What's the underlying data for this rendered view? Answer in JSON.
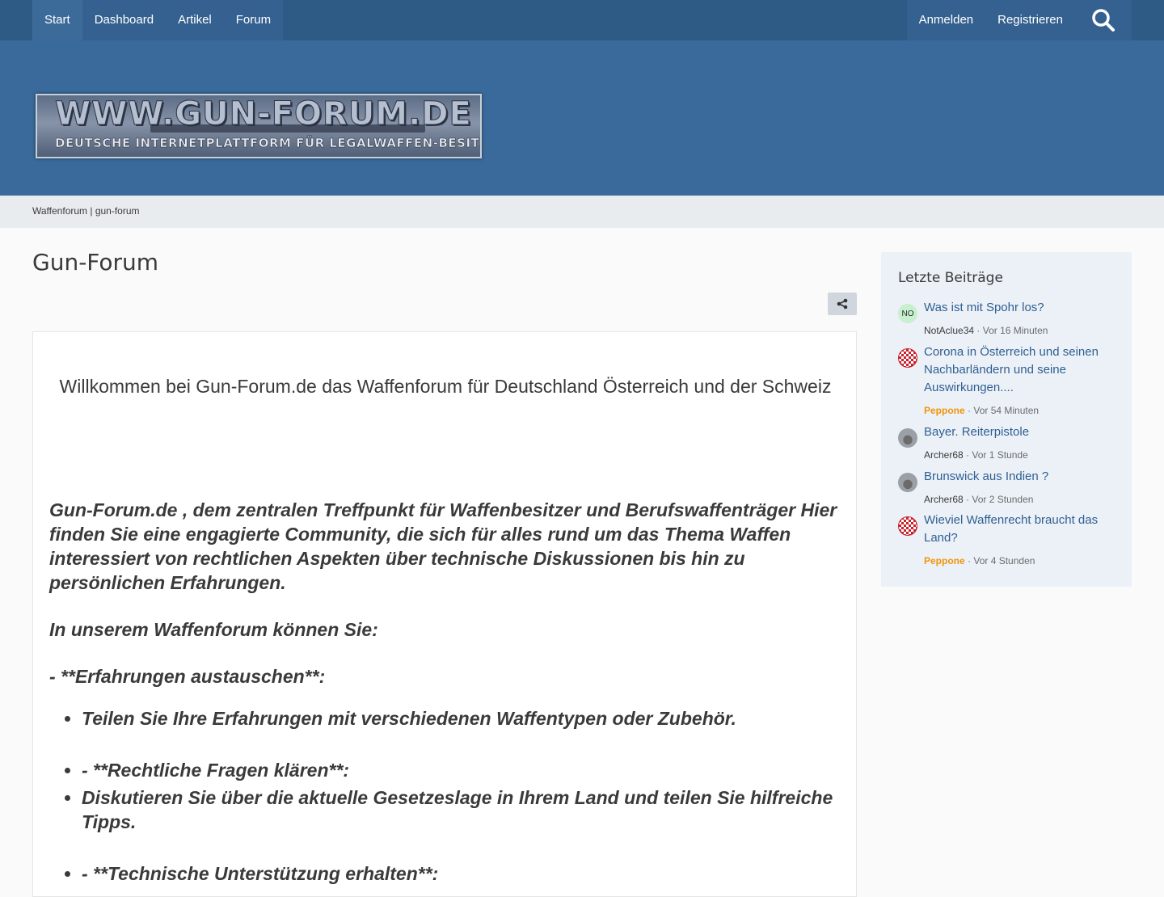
{
  "nav": {
    "left": [
      {
        "label": "Start"
      },
      {
        "label": "Dashboard"
      },
      {
        "label": "Artikel"
      },
      {
        "label": "Forum"
      }
    ],
    "right": [
      {
        "label": "Anmelden"
      },
      {
        "label": "Registrieren"
      }
    ],
    "search_icon": "search-icon"
  },
  "logo": {
    "line1": "WWW.GUN-FORUM.DE",
    "line2": "DEUTSCHE INTERNETPLATTFORM FÜR LEGALWAFFEN-BESITZER"
  },
  "breadcrumb": "Waffenforum | gun-forum",
  "page_title": "Gun-Forum",
  "share_icon": "share-icon",
  "content": {
    "welcome": "Willkommen bei Gun-Forum.de das Waffenforum für Deutschland Österreich und der Schweiz",
    "intro": "Gun-Forum.de , dem zentralen Treffpunkt für Waffenbesitzer und Berufswaffenträger Hier finden Sie eine engagierte Community, die sich für alles rund um das Thema Waffen interessiert von rechtlichen Aspekten über technische Diskussionen bis hin zu persönlichen Erfahrungen.",
    "can_do": "In unserem Waffenforum können Sie:",
    "section1": "- **Erfahrungen austauschen**:",
    "bullet1": "Teilen Sie Ihre Erfahrungen mit verschiedenen Waffentypen oder Zubehör.",
    "section2": "- **Rechtliche Fragen klären**:",
    "bullet2": "Diskutieren Sie über die aktuelle Gesetzeslage in Ihrem Land und teilen Sie hilfreiche Tipps.",
    "section3": "- **Technische Unterstützung erhalten**:"
  },
  "sidebar": {
    "title": "Letzte Beiträge",
    "posts": [
      {
        "avatar_text": "NO",
        "avatar_type": "initials",
        "title": "Was ist mit Spohr los?",
        "user": "NotAclue34",
        "time": "Vor 16 Minuten"
      },
      {
        "avatar_type": "checker",
        "title": "Corona in Österreich und seinen Nachbarländern und seine Auswirkungen....",
        "user": "Peppone",
        "time": "Vor 54 Minuten"
      },
      {
        "avatar_type": "gun",
        "title": "Bayer. Reiterpistole",
        "user": "Archer68",
        "time": "Vor 1 Stunde"
      },
      {
        "avatar_type": "gun",
        "title": "Brunswick aus Indien ?",
        "user": "Archer68",
        "time": "Vor 2 Stunden"
      },
      {
        "avatar_type": "checker",
        "title": "Wieviel Waffenrecht braucht das Land?",
        "user": "Peppone",
        "time": "Vor 4 Stunden"
      }
    ],
    "separator": "·"
  },
  "colors": {
    "topbar": "#2e5a86",
    "header": "#3a6a9b",
    "link": "#2e5f93",
    "special_user": "#f0940c"
  }
}
